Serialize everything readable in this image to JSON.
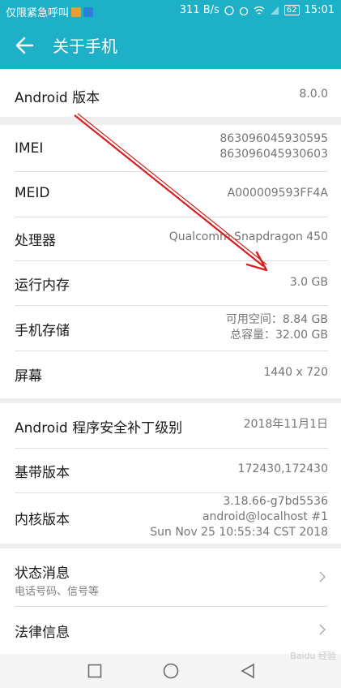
{
  "status": {
    "carrier": "仅限紧急呼叫",
    "speed": "311 B/s",
    "battery": "62",
    "time": "15:01"
  },
  "header": {
    "title": "关于手机",
    "back_icon": "arrow-left-icon"
  },
  "android": {
    "label": "Android 版本",
    "value": "8.0.0"
  },
  "imei": {
    "label": "IMEI",
    "value1": "863096045930595",
    "value2": "863096045930603"
  },
  "meid": {
    "label": "MEID",
    "value": "A000009593FF4A"
  },
  "processor": {
    "label": "处理器",
    "value": "Qualcomm Snapdragon 450"
  },
  "ram": {
    "label": "运行内存",
    "value": "3.0 GB"
  },
  "storage": {
    "label": "手机存储",
    "available": "可用空间：8.84  GB",
    "total": "总容量：32.00  GB"
  },
  "screen": {
    "label": "屏幕",
    "value": "1440 x 720"
  },
  "patch": {
    "label": "Android 程序安全补丁级别",
    "value": "2018年11月1日"
  },
  "baseband": {
    "label": "基带版本",
    "value": "172430,172430"
  },
  "kernel": {
    "label": "内核版本",
    "line1": "3.18.66-g7bd5536",
    "line2": "android@localhost #1",
    "line3": "Sun Nov 25 10:55:34 CST 2018"
  },
  "status_info": {
    "label": "状态消息",
    "sub": "电话号码、信号等"
  },
  "legal": {
    "label": "法律信息"
  },
  "watermark": "Baidu 经验",
  "colors": {
    "accent": "#1eb0c6",
    "annotation": "#d62020"
  }
}
